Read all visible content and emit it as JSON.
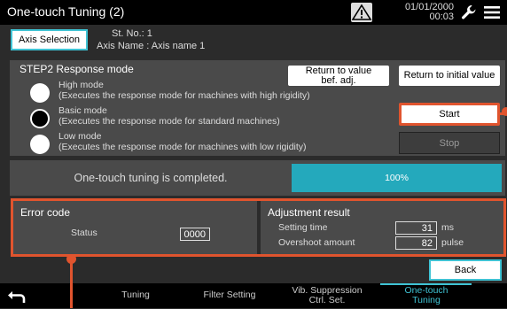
{
  "titlebar": {
    "title": "One-touch Tuning (2)",
    "date": "01/01/2000",
    "time": "00:03",
    "icons": [
      "warning-icon",
      "wrench-icon",
      "menu-icon"
    ]
  },
  "header": {
    "axis_selection_label": "Axis Selection",
    "station_no": "St. No.:   1",
    "axis_name": "Axis Name : Axis name 1"
  },
  "step2": {
    "title": "STEP2 Response mode",
    "return_bef_adj_label": "Return to value bef. adj.",
    "return_initial_label": "Return to initial value",
    "start_label": "Start",
    "stop_label": "Stop",
    "modes": [
      {
        "name": "High mode",
        "desc": "(Executes the response mode for machines with high rigidity)",
        "selected": false
      },
      {
        "name": "Basic mode",
        "desc": "(Executes the response mode for standard machines)",
        "selected": true
      },
      {
        "name": "Low mode",
        "desc": "(Executes the response mode for machines with low rigidity)",
        "selected": false
      }
    ]
  },
  "progress": {
    "message": "One-touch tuning is completed.",
    "percent_label": "100%",
    "fraction": 1.0
  },
  "error": {
    "header": "Error code",
    "status_label": "Status",
    "status_value": "0000"
  },
  "adjustment": {
    "header": "Adjustment result",
    "setting_time_label": "Setting time",
    "setting_time_value": "31",
    "setting_time_unit": "ms",
    "overshoot_label": "Overshoot amount",
    "overshoot_value": "82",
    "overshoot_unit": "pulse"
  },
  "back_label": "Back",
  "nav": {
    "tabs": [
      {
        "label": "Tuning",
        "active": false
      },
      {
        "label": "Filter Setting",
        "active": false
      },
      {
        "label": "Vib. Suppression Ctrl. Set.",
        "active": false
      },
      {
        "label": "One-touch Tuning",
        "active": true
      }
    ]
  },
  "colors": {
    "accent": "#3fc3d4",
    "progress": "#24a9bc",
    "highlight": "#e0542e",
    "panel": "#4a4a4a",
    "background": "#2b2b2b"
  }
}
